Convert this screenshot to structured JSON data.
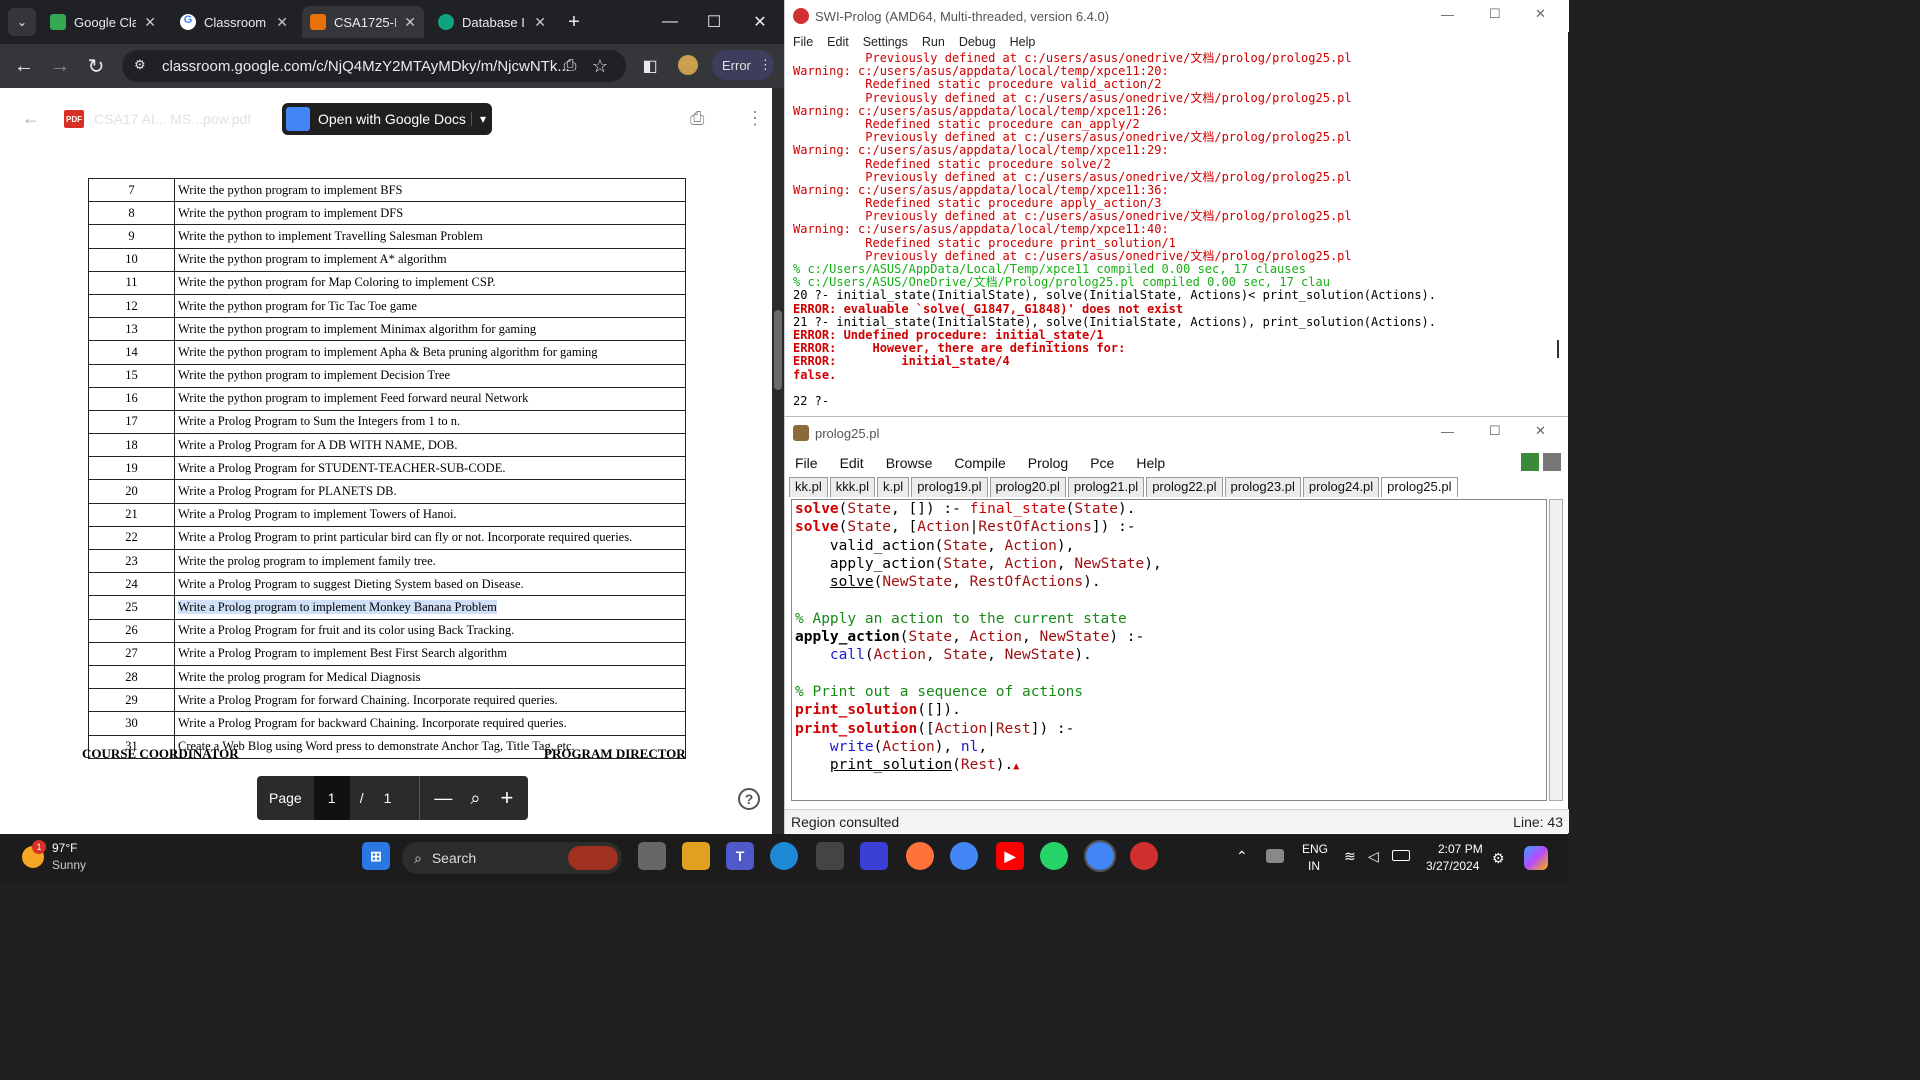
{
  "browser": {
    "tabs": [
      {
        "title": "Google Cla",
        "color": "#34a853"
      },
      {
        "title": "Classroom",
        "color": "#4285f4"
      },
      {
        "title": "CSA1725-I",
        "color": "#e8710a",
        "active": true
      },
      {
        "title": "Database I",
        "color": "#10a37f"
      }
    ],
    "url": "classroom.google.com/c/NjQ4MzY2MTAyMDky/m/NjcwNTk...",
    "error_label": "Error",
    "pdf_title": "CSA17  AI... MS...pow.pdf",
    "pdf_badge": "PDF",
    "open_with": "Open with Google Docs",
    "page_label": "Page",
    "page_current": "1",
    "page_sep": "/",
    "page_total": "1"
  },
  "tasks": [
    {
      "n": "7",
      "t": "Write the python program to implement BFS"
    },
    {
      "n": "8",
      "t": "Write the python program to implement DFS"
    },
    {
      "n": "9",
      "t": "Write the python to implement Travelling Salesman Problem"
    },
    {
      "n": "10",
      "t": "Write the python program to implement A* algorithm"
    },
    {
      "n": "11",
      "t": "Write the python program for Map Coloring to implement CSP."
    },
    {
      "n": "12",
      "t": "Write the python program for Tic Tac Toe game"
    },
    {
      "n": "13",
      "t": "Write the python program to implement Minimax algorithm for gaming"
    },
    {
      "n": "14",
      "t": "Write the python program to implement Apha & Beta pruning algorithm for gaming"
    },
    {
      "n": "15",
      "t": "Write the python program to implement Decision Tree"
    },
    {
      "n": "16",
      "t": "Write the python program to implement Feed forward neural Network"
    },
    {
      "n": "17",
      "t": "Write a Prolog Program to Sum the Integers from 1 to n."
    },
    {
      "n": "18",
      "t": "Write a Prolog Program for A DB WITH NAME, DOB."
    },
    {
      "n": "19",
      "t": "Write a Prolog Program for STUDENT-TEACHER-SUB-CODE."
    },
    {
      "n": "20",
      "t": "Write a Prolog Program for PLANETS DB."
    },
    {
      "n": "21",
      "t": "Write a Prolog Program to implement Towers of Hanoi."
    },
    {
      "n": "22",
      "t": "Write a Prolog Program to print particular bird can fly or not. Incorporate required queries."
    },
    {
      "n": "23",
      "t": "Write the prolog program to implement family tree."
    },
    {
      "n": "24",
      "t": "Write a Prolog Program to suggest Dieting System based on Disease."
    },
    {
      "n": "25",
      "t": "Write a Prolog program to implement Monkey Banana Problem",
      "highlight": true
    },
    {
      "n": "26",
      "t": "Write a Prolog Program for fruit and its color using Back Tracking."
    },
    {
      "n": "27",
      "t": "Write a Prolog Program to implement Best First Search algorithm"
    },
    {
      "n": "28",
      "t": "Write the prolog program for Medical Diagnosis"
    },
    {
      "n": "29",
      "t": "Write a Prolog Program for forward Chaining. Incorporate required queries."
    },
    {
      "n": "30",
      "t": "Write a Prolog Program for backward Chaining. Incorporate required queries."
    },
    {
      "n": "31",
      "t": "Create a Web Blog using Word press to demonstrate Anchor Tag, Title Tag, etc."
    }
  ],
  "signatures": {
    "left": "COURSE COORDINATOR",
    "right": "PROGRAM DIRECTOR"
  },
  "swi": {
    "title": "SWI-Prolog (AMD64, Multi-threaded, version 6.4.0)",
    "menu": [
      "File",
      "Edit",
      "Settings",
      "Run",
      "Debug",
      "Help"
    ],
    "console": [
      {
        "c": "cr",
        "t": "          Previously defined at c:/users/asus/onedrive/文档/prolog/prolog25.pl"
      },
      {
        "c": "cr",
        "t": "Warning: c:/users/asus/appdata/local/temp/xpce11:20:"
      },
      {
        "c": "cr",
        "t": "          Redefined static procedure valid_action/2"
      },
      {
        "c": "cr",
        "t": "          Previously defined at c:/users/asus/onedrive/文档/prolog/prolog25.pl"
      },
      {
        "c": "cr",
        "t": "Warning: c:/users/asus/appdata/local/temp/xpce11:26:"
      },
      {
        "c": "cr",
        "t": "          Redefined static procedure can_apply/2"
      },
      {
        "c": "cr",
        "t": "          Previously defined at c:/users/asus/onedrive/文档/prolog/prolog25.pl"
      },
      {
        "c": "cr",
        "t": "Warning: c:/users/asus/appdata/local/temp/xpce11:29:"
      },
      {
        "c": "cr",
        "t": "          Redefined static procedure solve/2"
      },
      {
        "c": "cr",
        "t": "          Previously defined at c:/users/asus/onedrive/文档/prolog/prolog25.pl"
      },
      {
        "c": "cr",
        "t": "Warning: c:/users/asus/appdata/local/temp/xpce11:36:"
      },
      {
        "c": "cr",
        "t": "          Redefined static procedure apply_action/3"
      },
      {
        "c": "cr",
        "t": "          Previously defined at c:/users/asus/onedrive/文档/prolog/prolog25.pl"
      },
      {
        "c": "cr",
        "t": "Warning: c:/users/asus/appdata/local/temp/xpce11:40:"
      },
      {
        "c": "cr",
        "t": "          Redefined static procedure print_solution/1"
      },
      {
        "c": "cr",
        "t": "          Previously defined at c:/users/asus/onedrive/文档/prolog/prolog25.pl"
      },
      {
        "c": "cg",
        "t": "% c:/Users/ASUS/AppData/Local/Temp/xpce11 compiled 0.00 sec, 17 clauses"
      },
      {
        "c": "cg",
        "t": "% c:/Users/ASUS/OneDrive/文档/Prolog/prolog25.pl compiled 0.00 sec, 17 clau"
      },
      {
        "c": "ck",
        "t": "20 ?- initial_state(InitialState), solve(InitialState, Actions)< print_solution(Actions)."
      },
      {
        "c": "cb",
        "t": "ERROR: evaluable `solve(_G1847,_G1848)' does not exist"
      },
      {
        "c": "ck",
        "t": "21 ?- initial_state(InitialState), solve(InitialState, Actions), print_solution(Actions)."
      },
      {
        "c": "cb",
        "t": "ERROR: Undefined procedure: initial_state/1"
      },
      {
        "c": "cb",
        "t": "ERROR:     However, there are definitions for:"
      },
      {
        "c": "cb",
        "t": "ERROR:         initial_state/4"
      },
      {
        "c": "cb",
        "t": "false."
      },
      {
        "c": "ck",
        "t": ""
      },
      {
        "c": "ck",
        "t": "22 ?-"
      }
    ]
  },
  "editor": {
    "title": "prolog25.pl",
    "menu": [
      "File",
      "Edit",
      "Browse",
      "Compile",
      "Prolog",
      "Pce",
      "Help"
    ],
    "tabs": [
      "kk.pl",
      "kkk.pl",
      "k.pl",
      "prolog19.pl",
      "prolog20.pl",
      "prolog21.pl",
      "prolog22.pl",
      "prolog23.pl",
      "prolog24.pl",
      "prolog25.pl"
    ],
    "status": "Region consulted",
    "line": "Line: 43"
  },
  "taskbar": {
    "weather_temp": "97°F",
    "weather_desc": "Sunny",
    "search": "Search",
    "lang1": "ENG",
    "lang2": "IN",
    "time": "2:07 PM",
    "date": "3/27/2024",
    "badge": "1"
  }
}
